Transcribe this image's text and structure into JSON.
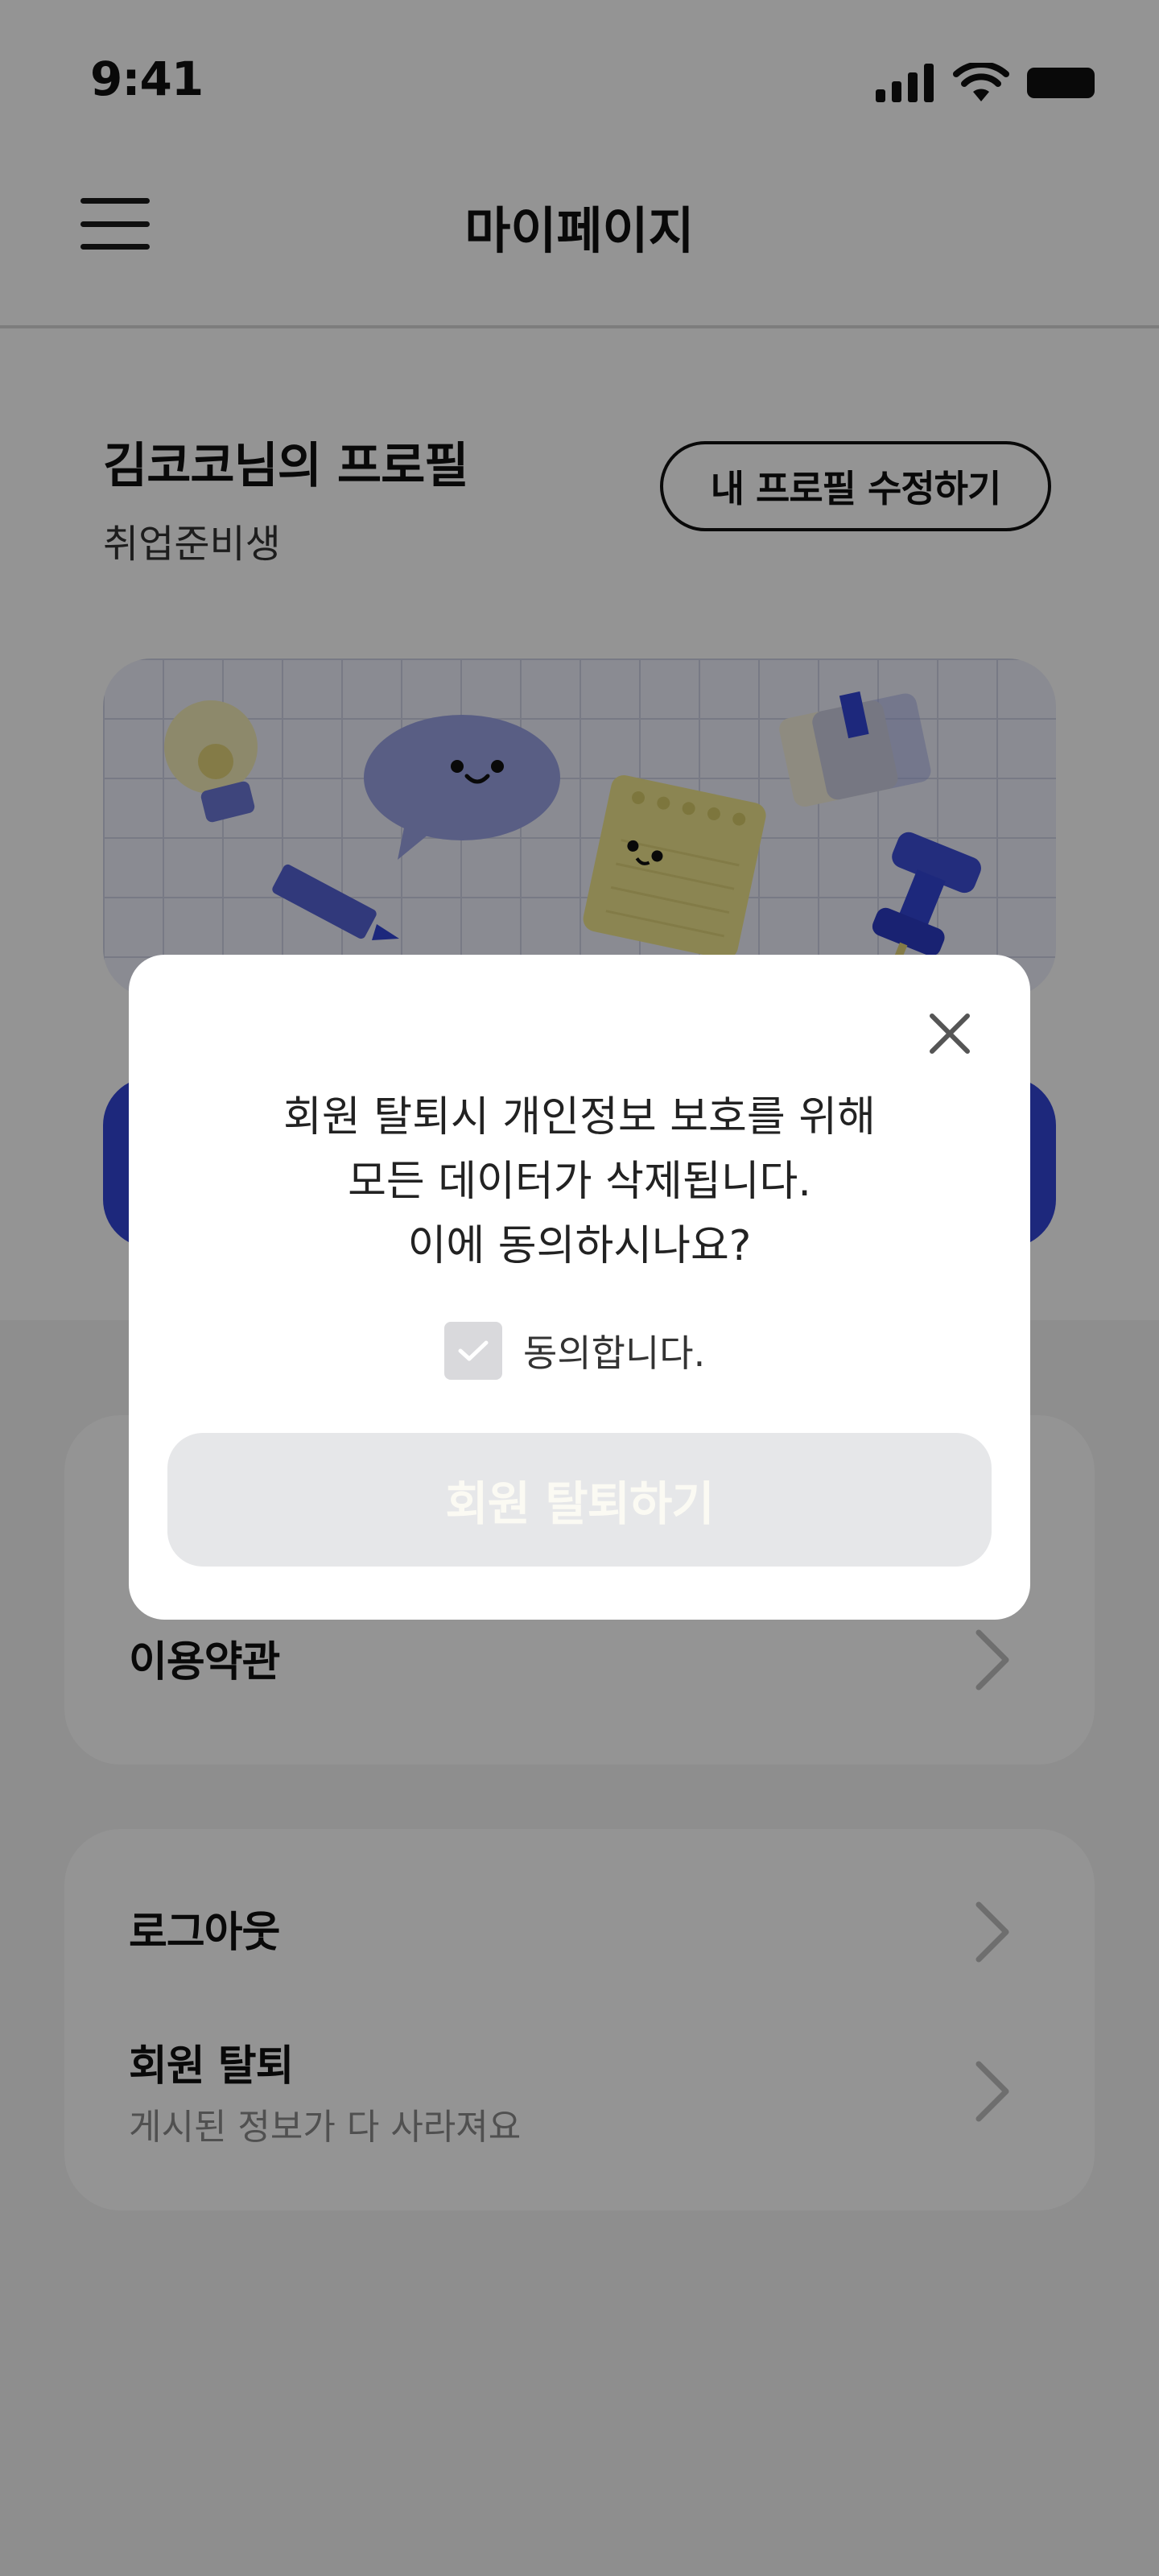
{
  "status_bar": {
    "time": "9:41"
  },
  "app_bar": {
    "title": "마이페이지"
  },
  "profile": {
    "name_title": "김코코님의 프로필",
    "role": "취업준비생",
    "edit_label": "내 프로필 수정하기"
  },
  "settings": {
    "group1": [
      {
        "label": "이용약관"
      }
    ],
    "group2": [
      {
        "label": "로그아웃"
      },
      {
        "label": "회원 탈퇴",
        "sub": "게시된 정보가 다 사라져요"
      }
    ]
  },
  "modal": {
    "message_lines": [
      "회원 탈퇴시 개인정보 보호를 위해",
      "모든 데이터가 삭제됩니다.",
      "이에 동의하시나요?"
    ],
    "agree_label": "동의합니다.",
    "agree_checked": false,
    "confirm_label": "회원 탈퇴하기",
    "confirm_enabled": false
  },
  "colors": {
    "accent_blue": "#3345d6",
    "disabled_button_bg": "#e6e7e9",
    "overlay": "rgba(0,0,0,0.42)"
  }
}
